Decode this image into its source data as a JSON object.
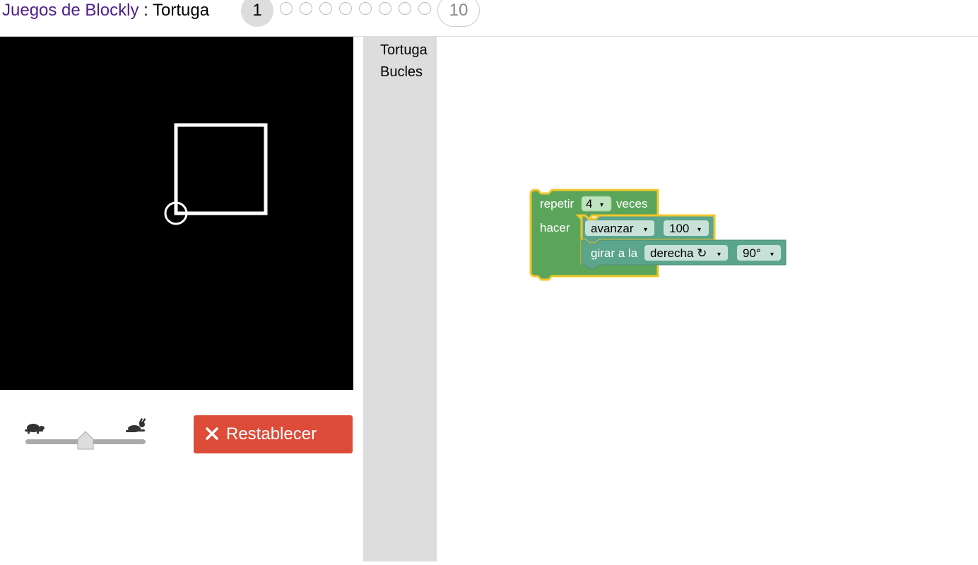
{
  "header": {
    "app_link": "Juegos de Blockly",
    "separator": " : ",
    "page_name": "Tortuga",
    "levels": {
      "current": "1",
      "total": 10,
      "last_label": "10"
    }
  },
  "speed": {
    "slow_icon": "turtle-icon",
    "fast_icon": "rabbit-icon",
    "value": 0.5
  },
  "reset_button": {
    "icon": "close-icon",
    "label": "Restablecer"
  },
  "toolbox": {
    "categories": [
      "Tortuga",
      "Bucles"
    ]
  },
  "blocks": {
    "repeat": {
      "label_before": "repetir",
      "count": "4",
      "label_after": "veces",
      "do_label": "hacer",
      "color": "#5ba55b",
      "highlight": "#f2c62b"
    },
    "move": {
      "direction": "avanzar",
      "distance": "100",
      "color": "#5ba58c"
    },
    "turn": {
      "label": "girar a la",
      "direction": "derecha ↻",
      "angle": "90°",
      "color": "#5ba58c"
    }
  },
  "colors": {
    "link": "#4f1e8c",
    "reset": "#dd4b39",
    "toolbox_bg": "#dddddd"
  }
}
